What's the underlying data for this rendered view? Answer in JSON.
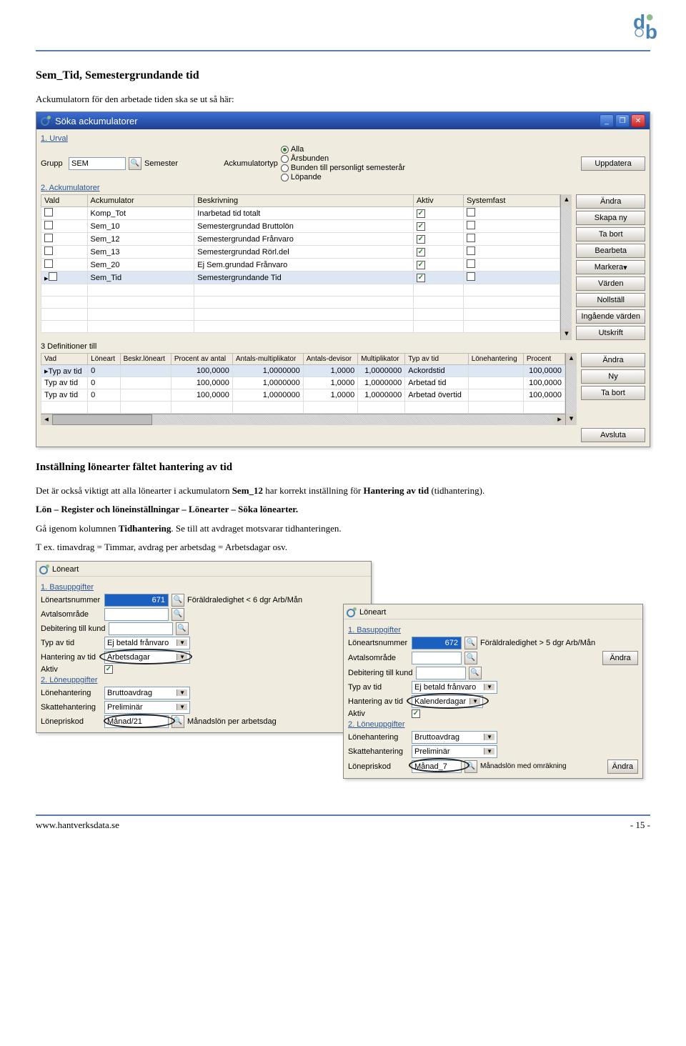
{
  "doc": {
    "h1": "Sem_Tid, Semestergrundande tid",
    "intro": "Ackumulatorn för den arbetade tiden ska se ut så här:",
    "h2": "Inställning lönearter fältet hantering av tid",
    "p2a": "Det är också viktigt att alla lönearter i ackumulatorn ",
    "p2b": " har korrekt inställning för ",
    "p2c": " (tidhantering).",
    "sem12": "Sem_12",
    "hantering": "Hantering av tid",
    "p3": "Lön – Register och löneinställningar – Lönearter – Söka lönearter.",
    "p4a": "Gå igenom kolumnen ",
    "p4b": ". Se till att avdraget motsvarar tidhanteringen.",
    "tidhantering": "Tidhantering",
    "p5": "T ex. timavdrag = Timmar, avdrag per arbetsdag = Arbetsdagar osv.",
    "footer_left": "www.hantverksdata.se",
    "footer_right": "- 15 -"
  },
  "win1": {
    "title": "Söka ackumulatorer",
    "sec1": "1. Urval",
    "grupp_label": "Grupp",
    "grupp_value": "SEM",
    "grupp_desc": "Semester",
    "acktyp_label": "Ackumulatortyp",
    "radios": [
      "Alla",
      "Årsbunden",
      "Bunden till personligt semesterår",
      "Löpande"
    ],
    "btn_uppdatera": "Uppdatera",
    "sec2": "2. Ackumulatorer",
    "cols2": [
      "Vald",
      "Ackumulator",
      "Beskrivning",
      "Aktiv",
      "Systemfast"
    ],
    "rows2": [
      {
        "vald": false,
        "ack": "Komp_Tot",
        "besk": "Inarbetad tid totalt",
        "aktiv": true,
        "sys": false
      },
      {
        "vald": false,
        "ack": "Sem_10",
        "besk": "Semestergrundad Bruttolön",
        "aktiv": true,
        "sys": false
      },
      {
        "vald": false,
        "ack": "Sem_12",
        "besk": "Semestergrundad Frånvaro",
        "aktiv": true,
        "sys": false
      },
      {
        "vald": false,
        "ack": "Sem_13",
        "besk": "Semestergrundad Rörl.del",
        "aktiv": true,
        "sys": false
      },
      {
        "vald": false,
        "ack": "Sem_20",
        "besk": "Ej Sem.grundad Frånvaro",
        "aktiv": true,
        "sys": false
      },
      {
        "vald": false,
        "ack": "Sem_Tid",
        "besk": "Semestergrundande Tid",
        "aktiv": true,
        "sys": false,
        "selected": true
      }
    ],
    "btns2": [
      "Ändra",
      "Skapa ny",
      "Ta bort",
      "Bearbeta",
      "Markera",
      "Värden",
      "Nollställ",
      "Ingående värden",
      "Utskrift"
    ],
    "sec3": "3 Definitioner till",
    "cols3": [
      "Vad",
      "Löneart",
      "Beskr.löneart",
      "Procent av antal",
      "Antals-multiplikator",
      "Antals-devisor",
      "Multiplikator",
      "Typ av tid",
      "Lönehantering",
      "Procent"
    ],
    "rows3": [
      {
        "vad": "Typ av tid",
        "lon": "0",
        "proc": "100,0000",
        "amul": "1,0000000",
        "adev": "1,0000",
        "mul": "1,0000000",
        "typ": "Ackordstid",
        "han": "",
        "pct": "100,0000",
        "selected": true
      },
      {
        "vad": "Typ av tid",
        "lon": "0",
        "proc": "100,0000",
        "amul": "1,0000000",
        "adev": "1,0000",
        "mul": "1,0000000",
        "typ": "Arbetad tid",
        "han": "",
        "pct": "100,0000"
      },
      {
        "vad": "Typ av tid",
        "lon": "0",
        "proc": "100,0000",
        "amul": "1,0000000",
        "adev": "1,0000",
        "mul": "1,0000000",
        "typ": "Arbetad övertid",
        "han": "",
        "pct": "100,0000"
      }
    ],
    "btns3": [
      "Ändra",
      "Ny",
      "Ta bort"
    ],
    "btn_avsluta": "Avsluta"
  },
  "win2": {
    "title": "Löneart",
    "sec1": "1. Basuppgifter",
    "left": {
      "num": "671",
      "desc": "Föräldraledighet < 6 dgr Arb/Mån",
      "labels": [
        "Löneartsnummer",
        "Avtalsområde",
        "Debitering till kund",
        "Typ av tid",
        "Hantering av tid",
        "Aktiv"
      ],
      "typ": "Ej betald frånvaro",
      "hant": "Arbetsdagar",
      "sec2": "2. Löneuppgifter",
      "labels2": [
        "Lönehantering",
        "Skattehantering",
        "Lönepriskod"
      ],
      "lonehant": "Bruttoavdrag",
      "skatt": "Preliminär",
      "pris": "Månad/21",
      "prisdesc": "Månadslön per arbetsdag"
    },
    "right": {
      "num": "672",
      "desc": "Föräldraledighet > 5 dgr Arb/Mån",
      "typ": "Ej betald frånvaro",
      "hant": "Kalenderdagar",
      "lonehant": "Bruttoavdrag",
      "skatt": "Preliminär",
      "pris": "Månad_7",
      "prisdesc": "Månadslön med omräkning",
      "btn_andra": "Ändra"
    }
  }
}
